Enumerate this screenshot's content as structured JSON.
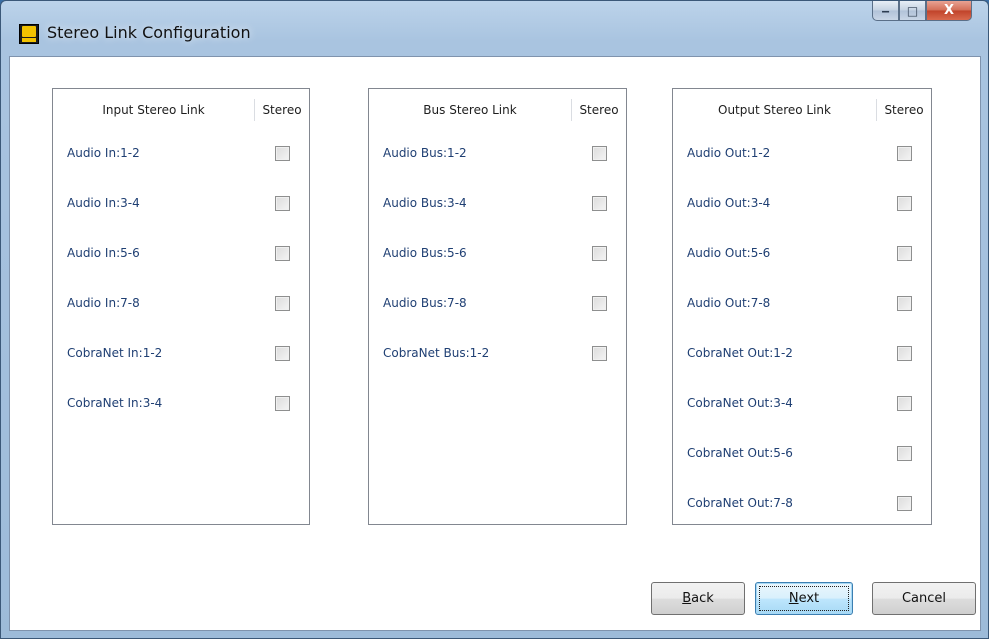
{
  "window": {
    "title": "Stereo Link Configuration",
    "min_glyph": "‒",
    "max_glyph": "□",
    "close_glyph": "X"
  },
  "stereo_header": "Stereo",
  "input_panel": {
    "header": "Input Stereo Link",
    "rows": [
      {
        "label": "Audio In:1-2",
        "checked": false
      },
      {
        "label": "Audio In:3-4",
        "checked": false
      },
      {
        "label": "Audio In:5-6",
        "checked": false
      },
      {
        "label": "Audio In:7-8",
        "checked": false
      },
      {
        "label": "CobraNet In:1-2",
        "checked": false
      },
      {
        "label": "CobraNet In:3-4",
        "checked": false
      }
    ]
  },
  "bus_panel": {
    "header": "Bus Stereo Link",
    "rows": [
      {
        "label": "Audio Bus:1-2",
        "checked": false
      },
      {
        "label": "Audio Bus:3-4",
        "checked": false
      },
      {
        "label": "Audio Bus:5-6",
        "checked": false
      },
      {
        "label": "Audio Bus:7-8",
        "checked": false
      },
      {
        "label": "CobraNet Bus:1-2",
        "checked": false
      }
    ]
  },
  "output_panel": {
    "header": "Output Stereo Link",
    "rows": [
      {
        "label": "Audio Out:1-2",
        "checked": false
      },
      {
        "label": "Audio Out:3-4",
        "checked": false
      },
      {
        "label": "Audio Out:5-6",
        "checked": false
      },
      {
        "label": "Audio Out:7-8",
        "checked": false
      },
      {
        "label": "CobraNet Out:1-2",
        "checked": false
      },
      {
        "label": "CobraNet Out:3-4",
        "checked": false
      },
      {
        "label": "CobraNet Out:5-6",
        "checked": false
      },
      {
        "label": "CobraNet Out:7-8",
        "checked": false
      }
    ]
  },
  "buttons": {
    "back_first": "B",
    "back_rest": "ack",
    "next_first": "N",
    "next_rest": "ext",
    "cancel": "Cancel"
  }
}
